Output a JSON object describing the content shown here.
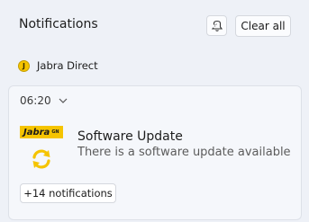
{
  "header": {
    "title": "Notifications",
    "dnd_icon": "do-not-disturb-icon",
    "clear_all_label": "Clear all"
  },
  "app_group": {
    "app_name": "Jabra Direct",
    "app_icon": "jabra-icon"
  },
  "notification": {
    "time": "06:20",
    "logo_text": "Jabra",
    "logo_superscript": "GN",
    "title": "Software Update",
    "body": "There is a software update available",
    "icon": "sync-icon",
    "more_label": "+14 notifications"
  },
  "colors": {
    "background": "#eef1f7",
    "card": "#f5f7fb",
    "jabra_yellow": "#f5c400"
  }
}
